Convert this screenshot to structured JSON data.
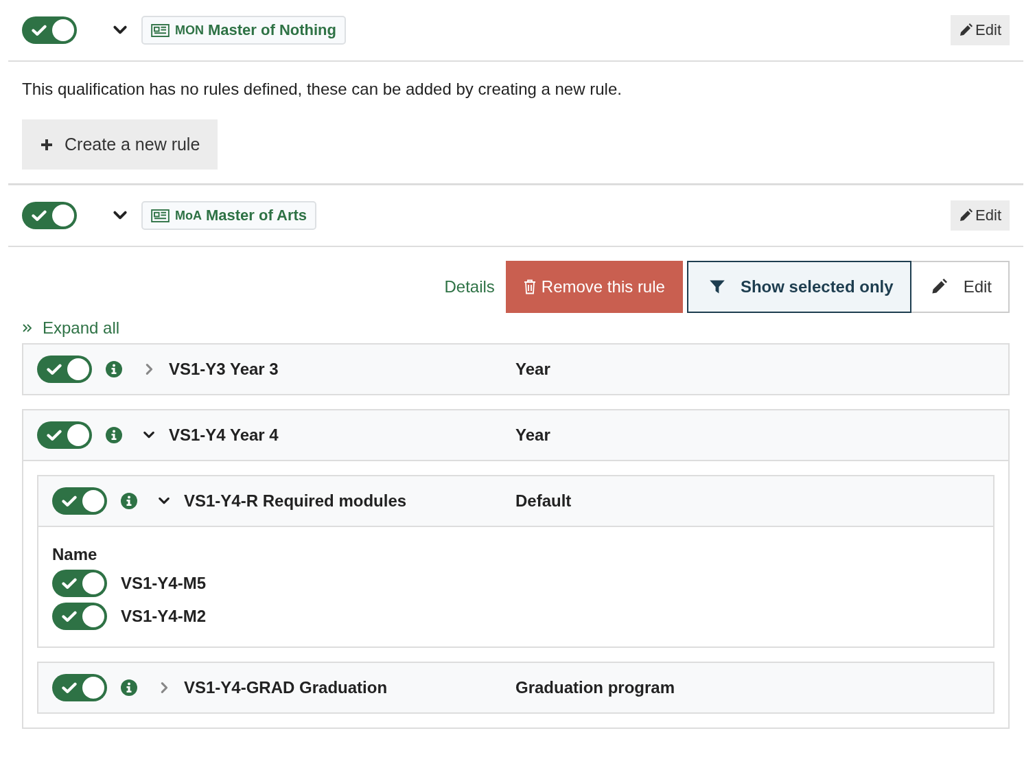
{
  "qualifications": [
    {
      "on": true,
      "expanded": true,
      "code": "MON",
      "name": "Master of Nothing",
      "edit": "Edit",
      "empty_message": "This qualification has no rules defined, these can be added by creating a new rule.",
      "create_button": "Create a new rule"
    },
    {
      "on": true,
      "expanded": true,
      "code": "MoA",
      "name": "Master of Arts",
      "edit": "Edit",
      "toolbar": {
        "details": "Details",
        "remove": "Remove this rule",
        "show_selected": "Show selected only",
        "show_selected_active": true,
        "edit": "Edit"
      },
      "expand_all": "Expand all",
      "rules": [
        {
          "on": true,
          "expanded": false,
          "title": "VS1-Y3 Year 3",
          "type": "Year"
        },
        {
          "on": true,
          "expanded": true,
          "title": "VS1-Y4 Year 4",
          "type": "Year",
          "children": [
            {
              "on": true,
              "expanded": true,
              "title": "VS1-Y4-R Required modules",
              "type": "Default",
              "modules": {
                "heading": "Name",
                "items": [
                  {
                    "on": true,
                    "name": "VS1-Y4-M5"
                  },
                  {
                    "on": true,
                    "name": "VS1-Y4-M2"
                  }
                ]
              }
            },
            {
              "on": true,
              "expanded": false,
              "title": "VS1-Y4-GRAD Graduation",
              "type": "Graduation program"
            }
          ]
        }
      ]
    }
  ]
}
